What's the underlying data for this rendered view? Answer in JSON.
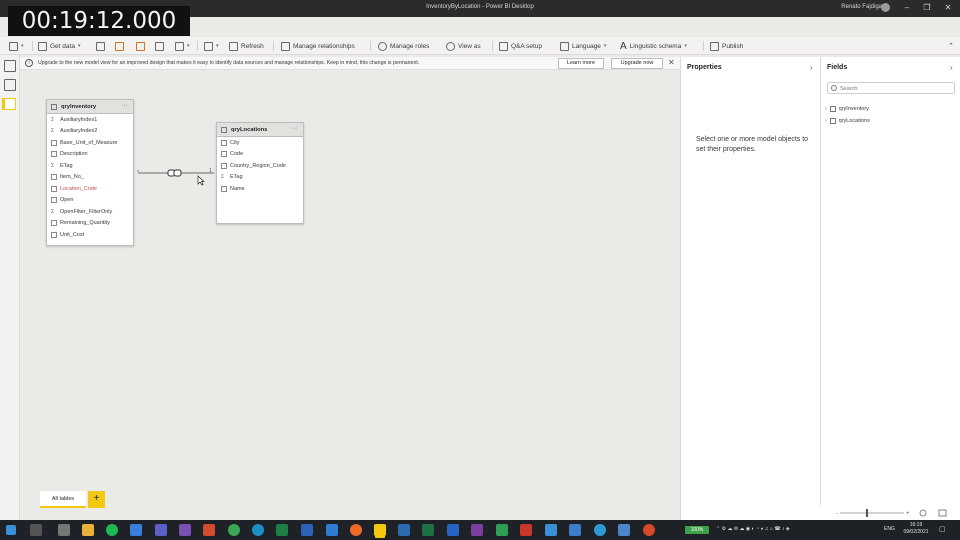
{
  "video_timestamp": "00:19:12.000",
  "window": {
    "title": "InventoryByLocation - Power BI Desktop",
    "user": "Renato Fajdiga"
  },
  "ribbon": {
    "get_data": "Get data",
    "refresh": "Refresh",
    "manage_relationships": "Manage relationships",
    "manage_roles": "Manage roles",
    "view_as": "View as",
    "qa_setup": "Q&A setup",
    "language": "Language",
    "linguistic_schema": "Linguistic schema",
    "publish": "Publish"
  },
  "infobar": {
    "message": "Upgrade to the new model view for an improved design that makes it easy to identify data sources and manage relationships. Keep in mind, this change is permanent.",
    "learn_more": "Learn more",
    "upgrade_now": "Upgrade now"
  },
  "tables": [
    {
      "name": "qryInventory",
      "fields": [
        {
          "label": "AuxiliaryIndex1",
          "type": "sigma"
        },
        {
          "label": "AuxiliaryIndex2",
          "type": "sigma"
        },
        {
          "label": "Base_Unit_of_Measure",
          "type": "text"
        },
        {
          "label": "Description",
          "type": "text"
        },
        {
          "label": "ETag",
          "type": "sigma"
        },
        {
          "label": "Item_No_",
          "type": "text"
        },
        {
          "label": "Location_Code",
          "type": "key"
        },
        {
          "label": "Open",
          "type": "text"
        },
        {
          "label": "OpenFilter_FilterOnly",
          "type": "sigma"
        },
        {
          "label": "Remaining_Quantity",
          "type": "text"
        },
        {
          "label": "Unit_Cost",
          "type": "text"
        }
      ]
    },
    {
      "name": "qryLocations",
      "fields": [
        {
          "label": "City",
          "type": "text"
        },
        {
          "label": "Code",
          "type": "text"
        },
        {
          "label": "Country_Region_Code",
          "type": "text"
        },
        {
          "label": "ETag",
          "type": "sigma"
        },
        {
          "label": "Name",
          "type": "text"
        }
      ]
    }
  ],
  "relationship": {
    "from_cardinality": "*",
    "to_cardinality": "1"
  },
  "page_tabs": {
    "active": "All tables",
    "add": "+"
  },
  "properties": {
    "title": "Properties",
    "message": "Select one or more model objects to set their properties."
  },
  "fields_pane": {
    "title": "Fields",
    "search_placeholder": "Search",
    "tables": [
      "qryInventory",
      "qryLocations"
    ]
  },
  "taskbar": {
    "battery": "100%",
    "language": "ENG",
    "time": "16:19",
    "date": "09/02/2021"
  },
  "colors": {
    "accent": "#f2c811",
    "titlebar": "#2b2b2b",
    "taskbar": "#1e2226"
  }
}
